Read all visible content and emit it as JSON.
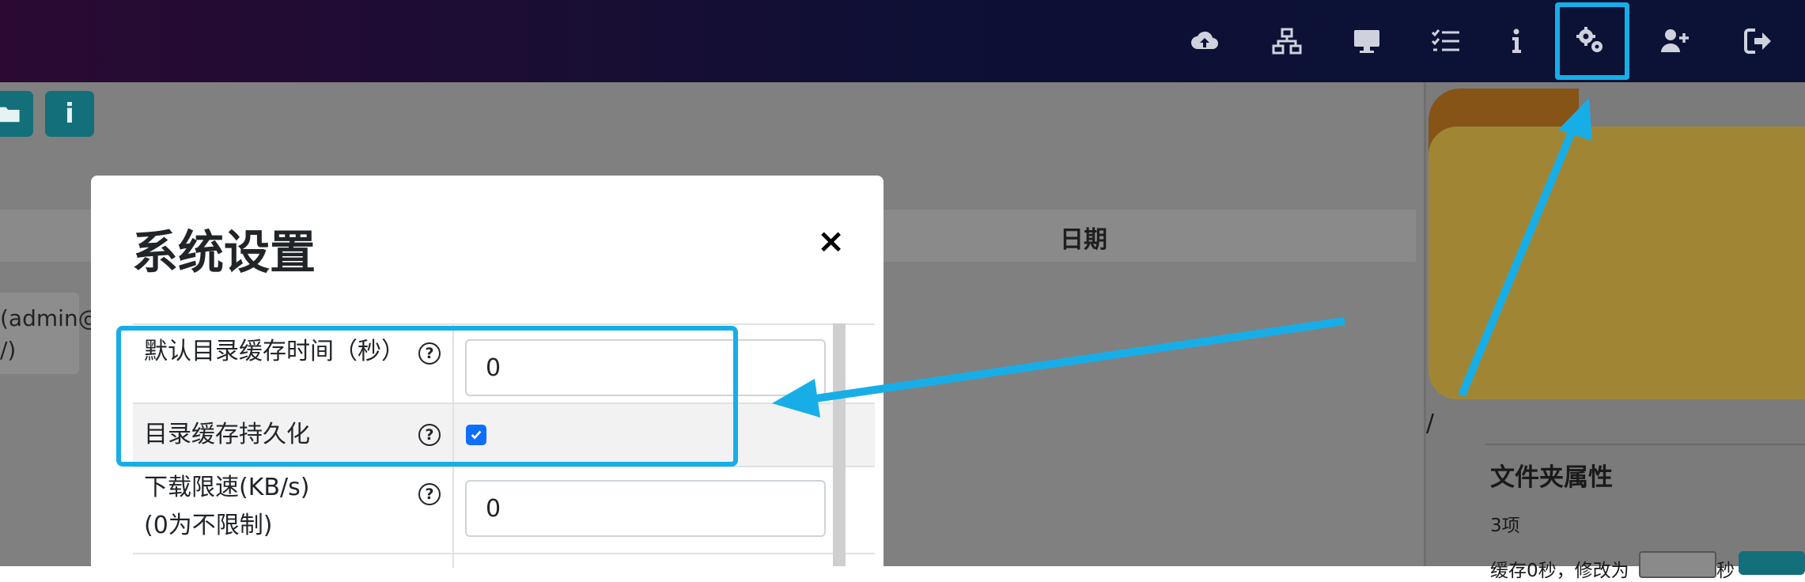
{
  "navbar": {
    "icons": [
      {
        "name": "cloud-upload-icon"
      },
      {
        "name": "network-icon"
      },
      {
        "name": "desktop-icon"
      },
      {
        "name": "task-list-icon"
      },
      {
        "name": "info-icon"
      },
      {
        "name": "settings-gears-icon"
      },
      {
        "name": "add-user-icon"
      },
      {
        "name": "logout-icon"
      }
    ]
  },
  "toolbar": {
    "info_glyph": "i"
  },
  "file_table": {
    "date_header": "日期"
  },
  "user_card": {
    "line1": "(admin@",
    "line2": "/)"
  },
  "right_panel": {
    "path": "/",
    "title": "文件夹属性",
    "item_count": "3项",
    "cache_text": "缓存0秒，修改为",
    "cache_unit": "秒"
  },
  "modal": {
    "title": "系统设置",
    "close_label": "×",
    "rows": [
      {
        "label": "默认目录缓存时间（秒）",
        "help": "?",
        "value": "0"
      },
      {
        "label": "目录缓存持久化",
        "help": "?",
        "checked": true
      },
      {
        "label_line1": "下载限速(KB/s)",
        "label_line2": "(0为不限制)",
        "help": "?",
        "value": "0"
      }
    ]
  },
  "colors": {
    "annotation": "#17aee8",
    "teal_button": "#136f7a",
    "checkbox": "#0d6efd"
  }
}
